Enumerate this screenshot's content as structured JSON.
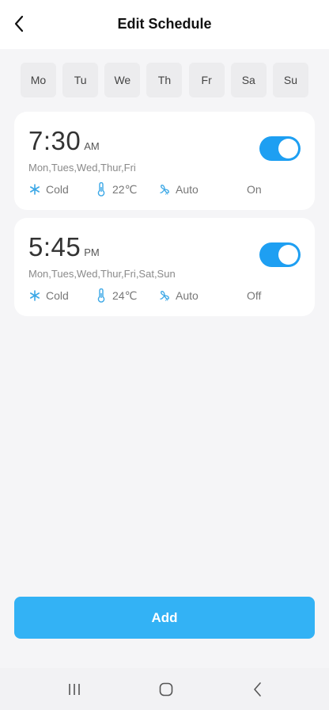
{
  "header": {
    "title": "Edit Schedule"
  },
  "weekdays": [
    "Mo",
    "Tu",
    "We",
    "Th",
    "Fr",
    "Sa",
    "Su"
  ],
  "schedules": [
    {
      "time": "7:30",
      "period": "AM",
      "days": "Mon,Tues,Wed,Thur,Fri",
      "mode": "Cold",
      "temperature": "22℃",
      "fan": "Auto",
      "power": "On",
      "enabled": true
    },
    {
      "time": "5:45",
      "period": "PM",
      "days": "Mon,Tues,Wed,Thur,Fri,Sat,Sun",
      "mode": "Cold",
      "temperature": "24℃",
      "fan": "Auto",
      "power": "Off",
      "enabled": true
    }
  ],
  "actions": {
    "add_label": "Add"
  },
  "icons": {
    "back": "chevron-left-icon",
    "mode": "snowflake-icon",
    "temperature": "thermometer-icon",
    "fan": "fan-icon",
    "nav_recent": "recent-apps-icon",
    "nav_home": "home-icon",
    "nav_back": "nav-back-icon"
  },
  "colors": {
    "accent": "#1e9ff2",
    "add_button": "#33b2f5",
    "icon_blue": "#3aa7e6",
    "background": "#f5f5f7"
  }
}
